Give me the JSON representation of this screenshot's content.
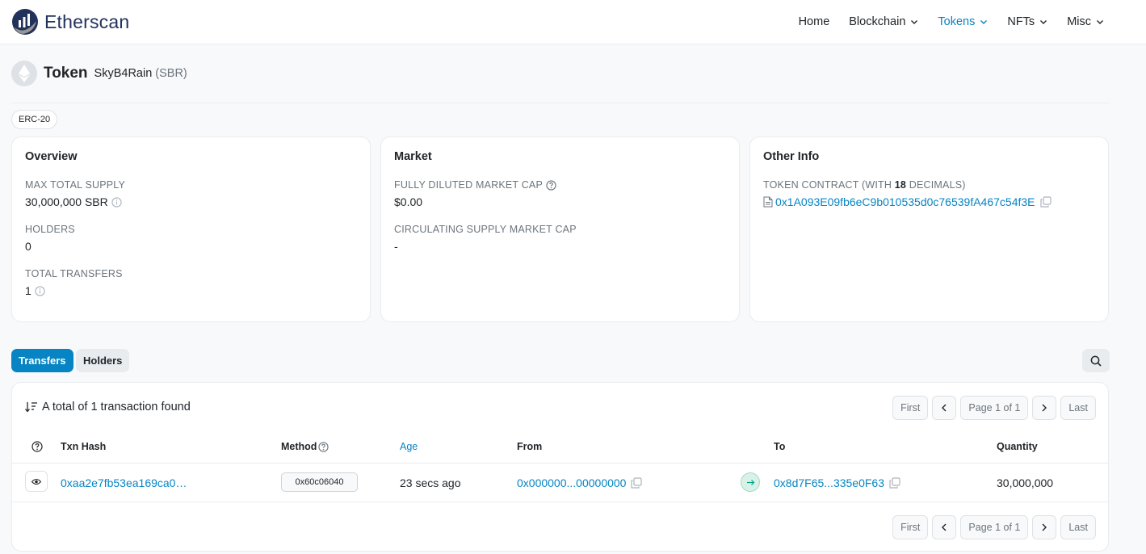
{
  "header": {
    "logo_text": "Etherscan",
    "nav": [
      {
        "label": "Home",
        "dropdown": false,
        "active": false
      },
      {
        "label": "Blockchain",
        "dropdown": true,
        "active": false
      },
      {
        "label": "Tokens",
        "dropdown": true,
        "active": true
      },
      {
        "label": "NFTs",
        "dropdown": true,
        "active": false
      },
      {
        "label": "Misc",
        "dropdown": true,
        "active": false
      }
    ]
  },
  "token": {
    "title_word": "Token",
    "name": "SkyB4Rain",
    "symbol": "(SBR)",
    "standard": "ERC-20"
  },
  "overview": {
    "title": "Overview",
    "max_supply_label": "MAX TOTAL SUPPLY",
    "max_supply_value": "30,000,000 SBR",
    "holders_label": "HOLDERS",
    "holders_value": "0",
    "transfers_label": "TOTAL TRANSFERS",
    "transfers_value": "1"
  },
  "market": {
    "title": "Market",
    "fdmc_label": "FULLY DILUTED MARKET CAP",
    "fdmc_value": "$0.00",
    "csmc_label": "CIRCULATING SUPPLY MARKET CAP",
    "csmc_value": "-"
  },
  "other_info": {
    "title": "Other Info",
    "contract_label_prefix": "TOKEN CONTRACT (WITH ",
    "contract_decimals": "18",
    "contract_label_suffix": " DECIMALS)",
    "contract_address": "0x1A093E09fb6eC9b010535d0c76539fA467c54f3E"
  },
  "tabs": {
    "transfers": "Transfers",
    "holders": "Holders"
  },
  "table": {
    "total_text": "A total of 1 transaction found",
    "pager": {
      "first": "First",
      "prev": "<",
      "page": "Page 1 of 1",
      "next": ">",
      "last": "Last"
    },
    "columns": {
      "txn_hash": "Txn Hash",
      "method": "Method",
      "age": "Age",
      "from": "From",
      "to": "To",
      "quantity": "Quantity"
    },
    "rows": [
      {
        "txn_hash": "0xaa2e7fb53ea169ca0…",
        "method": "0x60c06040",
        "age": "23 secs ago",
        "from": "0x000000...00000000",
        "to": "0x8d7F65...335e0F63",
        "quantity": "30,000,000"
      }
    ]
  },
  "colors": {
    "accent": "#0784c3",
    "brand": "#21325b",
    "muted": "#6c757d"
  }
}
